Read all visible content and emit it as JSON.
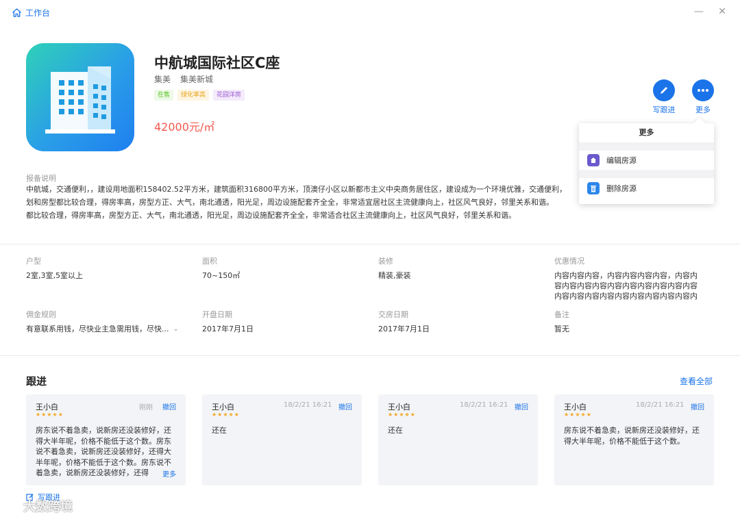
{
  "titlebar": {
    "home_label": "工作台",
    "minimize": "—",
    "close": "✕"
  },
  "property": {
    "title": "中航城国际社区C座",
    "district": "集美",
    "area": "集美新城",
    "tags": [
      "在售",
      "绿化率高",
      "花园洋房"
    ],
    "price": "42000元/㎡"
  },
  "actions": {
    "follow_label": "写跟进",
    "more_label": "更多"
  },
  "more_menu": {
    "title": "更多",
    "items": [
      {
        "label": "编辑房源",
        "icon": "home-icon"
      },
      {
        "label": "删除房源",
        "icon": "trash-icon"
      }
    ]
  },
  "description": {
    "label": "报备说明",
    "lines": [
      "中航城，交通便利，，建设用地面积158402.52平方米，建筑面积316800平方米，顶澳仔小区以新都市主义中央商务居住区，建设成为一个环境优雅，交通便利，",
      "划和房型都比较合理，得房率高，房型方正、大气，南北通透，阳光足，周边设施配套齐全全，非常适宜居社区主流健康向上，社区风气良好，邻里关系和谐。",
      "都比较合理，得房率高，房型方正、大气，南北通透，阳光足，周边设施配套齐全全，非常适合社区主流健康向上，社区风气良好，邻里关系和谐。"
    ]
  },
  "info": {
    "layout": {
      "label": "户型",
      "value": "2室,3室,5室以上"
    },
    "area": {
      "label": "面积",
      "value": "70~150㎡"
    },
    "decoration": {
      "label": "装修",
      "value": "精装,豪装"
    },
    "discount": {
      "label": "优惠情况",
      "lines": [
        "内容内容内容，内容内容内容内容，内容内",
        "容内容内容内容内容内容内容内容内容内容",
        "内容内容内容内容内容内容内容内容内容内"
      ]
    },
    "commission": {
      "label": "佣金规则",
      "value": "有意联系用钱，尽快业主急需用钱，尽快..."
    },
    "open_date": {
      "label": "开盘日期",
      "value": "2017年7月1日"
    },
    "delivery_date": {
      "label": "交房日期",
      "value": "2017年7月1日"
    },
    "remark": {
      "label": "备注",
      "value": "暂无"
    }
  },
  "followup": {
    "title": "跟进",
    "see_all": "查看全部",
    "write_label": "写跟进",
    "cards": [
      {
        "name": "王小白",
        "time": "刚刚",
        "revoke": "撤回",
        "stars": "★★★★★",
        "body": "房东说不着急卖，说新房还没装修好，还得大半年呢，价格不能低于这个数。房东说不着急卖，说新房还没装修好，还得大半年呢，价格不能低于这个数。房东说不着急卖，说新房还没装修好，还得",
        "more": "更多"
      },
      {
        "name": "王小白",
        "time": "18/2/21 16:21",
        "revoke": "撤回",
        "stars": "★★★★★",
        "body": "还在"
      },
      {
        "name": "王小白",
        "time": "18/2/21 16:21",
        "revoke": "撤回",
        "stars": "★★★★★",
        "body": "还在"
      },
      {
        "name": "王小白",
        "time": "18/2/21 16:21",
        "revoke": "撤回",
        "stars": "★★★★★",
        "body": "房东说不着急卖，说新房还没装修好，还得大半年呢，价格不能低于这个数。"
      }
    ]
  },
  "watermark": "大数跨境",
  "colors": {
    "accent": "#1a73e8",
    "price": "#f05a4f",
    "card_bg": "#f3f4f7"
  }
}
